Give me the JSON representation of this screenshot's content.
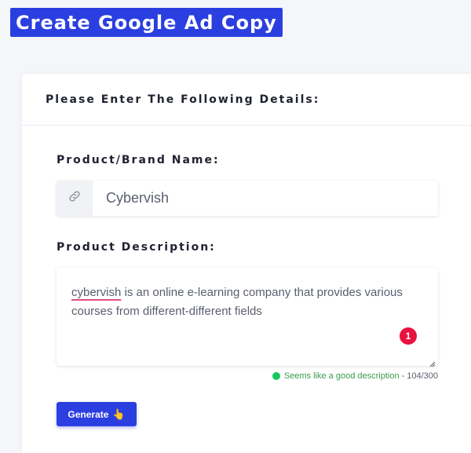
{
  "header": {
    "title": "Create Google Ad Copy"
  },
  "card": {
    "heading": "Please Enter The Following Details:"
  },
  "brand_field": {
    "label": "Product/Brand Name:",
    "value": "Cybervish",
    "icon": "link-icon"
  },
  "description_field": {
    "label": "Product Description:",
    "value_misspelled": "cybervish",
    "value_rest": " is an online e-learning company that provides various courses from different-different fields",
    "issue_count": "1"
  },
  "validation": {
    "message": "Seems like a good description",
    "separator": "-",
    "char_count": "104/300",
    "status_color": "#14c95b"
  },
  "generate_button": {
    "label": "Generate",
    "icon": "pointing-hand-icon",
    "icon_glyph": "👆"
  },
  "colors": {
    "accent": "#2b3fe0",
    "badge": "#e8113f",
    "success_text": "#3a9b4d"
  }
}
